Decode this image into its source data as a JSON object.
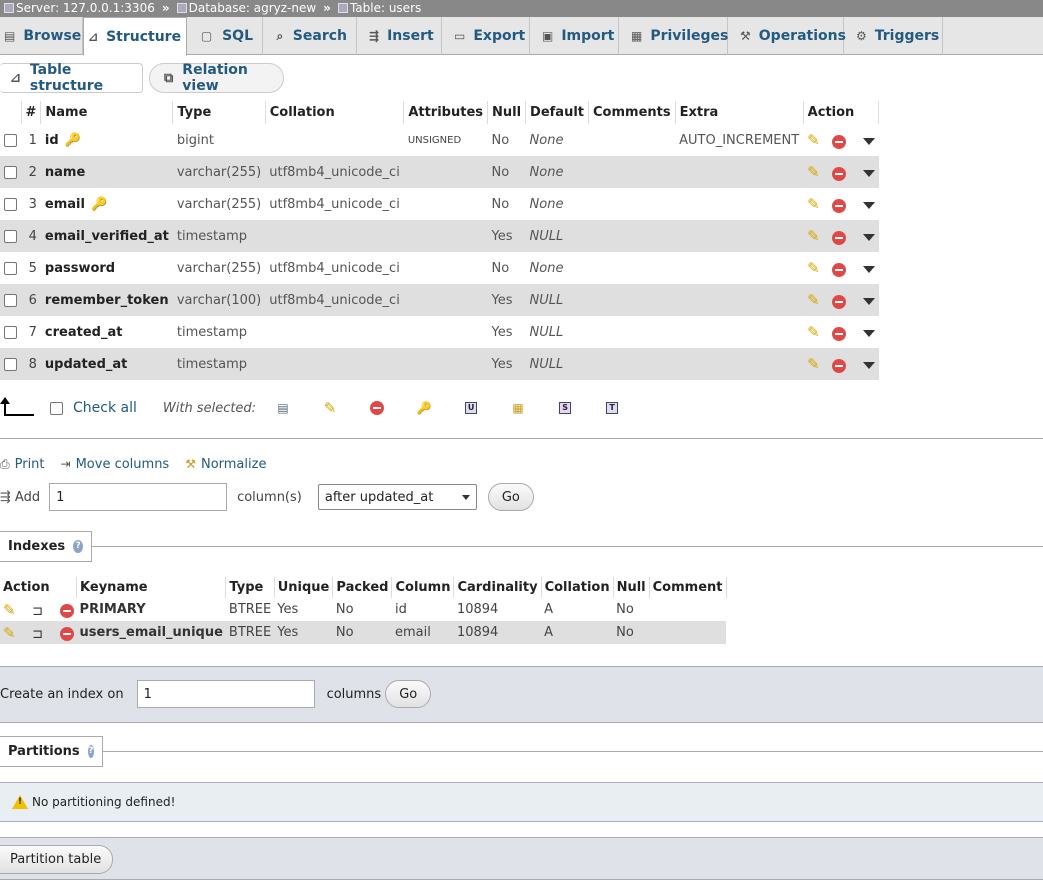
{
  "breadcrumb": {
    "server": "Server: 127.0.0.1:3306",
    "database": "Database: agryz-new",
    "table": "Table: users",
    "separator": "»"
  },
  "tabs": [
    {
      "label": "Browse",
      "icon": "browse-icon"
    },
    {
      "label": "Structure",
      "icon": "structure-icon",
      "active": true
    },
    {
      "label": "SQL",
      "icon": "sql-icon"
    },
    {
      "label": "Search",
      "icon": "search-icon"
    },
    {
      "label": "Insert",
      "icon": "insert-icon"
    },
    {
      "label": "Export",
      "icon": "export-icon"
    },
    {
      "label": "Import",
      "icon": "import-icon"
    },
    {
      "label": "Privileges",
      "icon": "privileges-icon"
    },
    {
      "label": "Operations",
      "icon": "wrench-icon"
    },
    {
      "label": "Triggers",
      "icon": "triggers-icon"
    }
  ],
  "subtabs": {
    "table_structure": "Table structure",
    "relation_view": "Relation view"
  },
  "structure_table": {
    "headers": [
      "#",
      "Name",
      "Type",
      "Collation",
      "Attributes",
      "Null",
      "Default",
      "Comments",
      "Extra",
      "Action"
    ],
    "rows": [
      {
        "num": "1",
        "name": "id",
        "type": "bigint",
        "collation": "",
        "attributes": "UNSIGNED",
        "null": "No",
        "default": "None",
        "comments": "",
        "extra": "AUTO_INCREMENT",
        "key": "primary"
      },
      {
        "num": "2",
        "name": "name",
        "type": "varchar(255)",
        "collation": "utf8mb4_unicode_ci",
        "attributes": "",
        "null": "No",
        "default": "None",
        "comments": "",
        "extra": ""
      },
      {
        "num": "3",
        "name": "email",
        "type": "varchar(255)",
        "collation": "utf8mb4_unicode_ci",
        "attributes": "",
        "null": "No",
        "default": "None",
        "comments": "",
        "extra": "",
        "key": "unique"
      },
      {
        "num": "4",
        "name": "email_verified_at",
        "type": "timestamp",
        "collation": "",
        "attributes": "",
        "null": "Yes",
        "default": "NULL",
        "comments": "",
        "extra": ""
      },
      {
        "num": "5",
        "name": "password",
        "type": "varchar(255)",
        "collation": "utf8mb4_unicode_ci",
        "attributes": "",
        "null": "No",
        "default": "None",
        "comments": "",
        "extra": ""
      },
      {
        "num": "6",
        "name": "remember_token",
        "type": "varchar(100)",
        "collation": "utf8mb4_unicode_ci",
        "attributes": "",
        "null": "Yes",
        "default": "NULL",
        "comments": "",
        "extra": ""
      },
      {
        "num": "7",
        "name": "created_at",
        "type": "timestamp",
        "collation": "",
        "attributes": "",
        "null": "Yes",
        "default": "NULL",
        "comments": "",
        "extra": ""
      },
      {
        "num": "8",
        "name": "updated_at",
        "type": "timestamp",
        "collation": "",
        "attributes": "",
        "null": "Yes",
        "default": "NULL",
        "comments": "",
        "extra": ""
      }
    ]
  },
  "bulk": {
    "check_all": "Check all",
    "with_selected": "With selected:"
  },
  "links": {
    "print": "Print",
    "move_columns": "Move columns",
    "normalize": "Normalize"
  },
  "add_column": {
    "label": "Add",
    "count": "1",
    "unit": "column(s)",
    "position": "after updated_at",
    "go": "Go"
  },
  "indexes": {
    "title": "Indexes",
    "headers": [
      "Action",
      "Keyname",
      "Type",
      "Unique",
      "Packed",
      "Column",
      "Cardinality",
      "Collation",
      "Null",
      "Comment"
    ],
    "rows": [
      {
        "keyname": "PRIMARY",
        "type": "BTREE",
        "unique": "Yes",
        "packed": "No",
        "column": "id",
        "cardinality": "10894",
        "collation": "A",
        "null": "No",
        "comment": ""
      },
      {
        "keyname": "users_email_unique",
        "type": "BTREE",
        "unique": "Yes",
        "packed": "No",
        "column": "email",
        "cardinality": "10894",
        "collation": "A",
        "null": "No",
        "comment": ""
      }
    ]
  },
  "create_index": {
    "label": "Create an index on",
    "count": "1",
    "unit": "columns",
    "go": "Go"
  },
  "partitions": {
    "title": "Partitions",
    "notice": "No partitioning defined!",
    "button": "Partition table"
  },
  "help_glyph": "?",
  "colors": {
    "link": "#235a81",
    "row_alt": "#dfdfdf",
    "delete": "#e04848",
    "edit": "#d8a400"
  }
}
